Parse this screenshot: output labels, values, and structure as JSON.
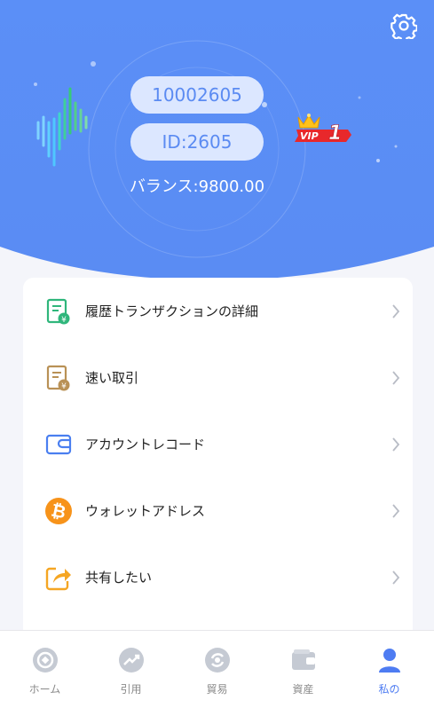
{
  "header": {
    "username": "10002605",
    "user_id": "ID:2605",
    "balance": "バランス:9800.00",
    "vip_prefix": "VIP",
    "vip_level": "1",
    "settings_icon": "gear-icon"
  },
  "menu": {
    "items": [
      {
        "label": "履歴トランザクションの詳細",
        "icon": "receipt-yen-green-icon"
      },
      {
        "label": "速い取引",
        "icon": "receipt-yen-gold-icon"
      },
      {
        "label": "アカウントレコード",
        "icon": "wallet-outline-icon"
      },
      {
        "label": "ウォレットアドレス",
        "icon": "bitcoin-icon"
      },
      {
        "label": "共有したい",
        "icon": "share-icon"
      }
    ]
  },
  "tabbar": {
    "tabs": [
      {
        "label": "ホーム",
        "icon": "home-icon",
        "active": false
      },
      {
        "label": "引用",
        "icon": "trend-icon",
        "active": false
      },
      {
        "label": "貿易",
        "icon": "exchange-icon",
        "active": false
      },
      {
        "label": "資産",
        "icon": "wallet-icon",
        "active": false
      },
      {
        "label": "私の",
        "icon": "person-icon",
        "active": true
      }
    ]
  },
  "colors": {
    "primary": "#5a8ff5",
    "active_tab": "#4e7cf2",
    "inactive_tab": "#b9bdc6"
  }
}
